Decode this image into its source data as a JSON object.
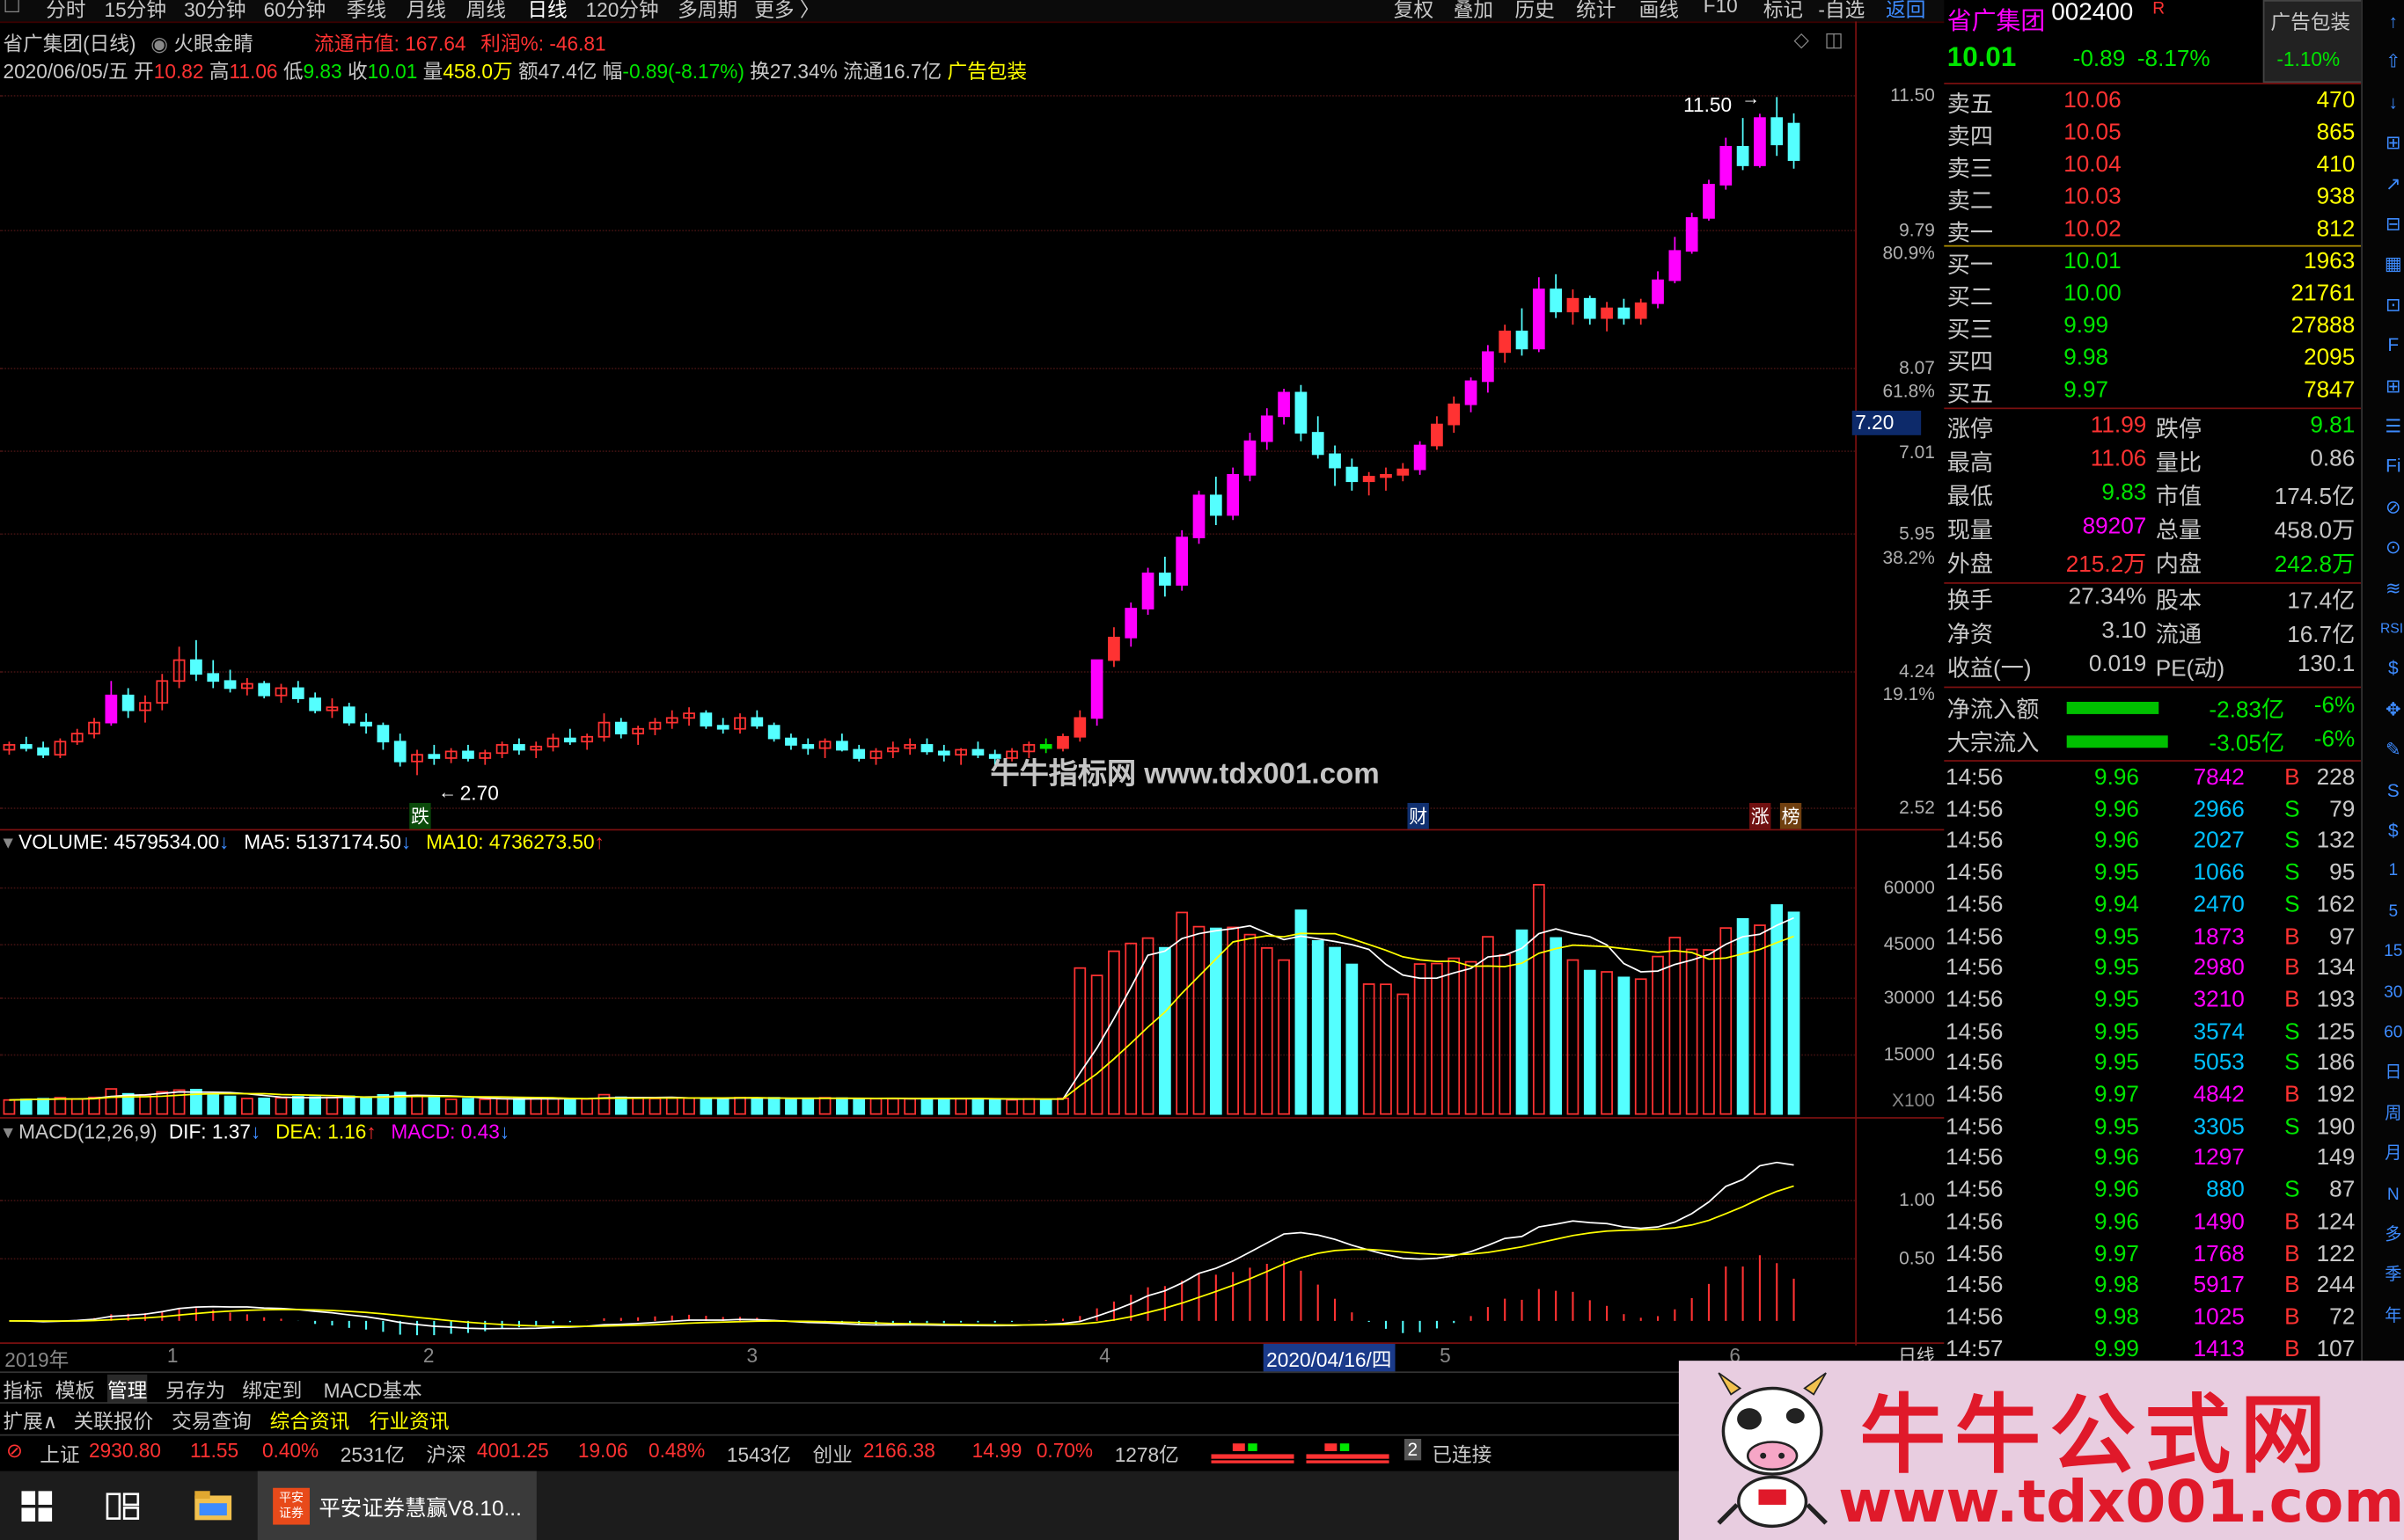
{
  "topbar": {
    "periods": [
      "分时",
      "15分钟",
      "30分钟",
      "60分钟",
      "季线",
      "月线",
      "周线",
      "日线",
      "120分钟",
      "多周期",
      "更多 〉"
    ],
    "active": "日线",
    "right": [
      "复权",
      "叠加",
      "历史",
      "统计",
      "画线",
      "F10",
      "标记",
      "-自选",
      "返回"
    ]
  },
  "header": {
    "title": "省广集团(日线)",
    "indicator": "火眼金睛",
    "float_cap_label": "流通市值:",
    "float_cap": "167.64",
    "profit_label": "利润%:",
    "profit": "-46.81",
    "date": "2020/06/05/五",
    "open_label": "开",
    "open": "10.82",
    "high_label": "高",
    "high": "11.06",
    "low_label": "低",
    "low": "9.83",
    "close_label": "收",
    "close": "10.01",
    "vol_label": "量",
    "vol": "458.0万",
    "amt_label": "额",
    "amt": "47.4亿",
    "chg_label": "幅",
    "chg": "-0.89(-8.17%)",
    "turn_label": "换",
    "turn": "27.34%",
    "circ_label": "流通",
    "circ": "16.7亿",
    "ad": "广告包装"
  },
  "colors": {
    "up": "#ff3232",
    "down": "#54ffff",
    "bull_solid": "#ff00ff",
    "green_mark": "#00e600",
    "ma_white": "#ffffff",
    "ma_yellow": "#ffff00",
    "label_blue": "#3d8bff"
  },
  "chart_data": {
    "type": "candlestick",
    "price_axis": {
      "ticks": [
        "11.50",
        "9.79",
        "8.07",
        "7.01",
        "5.95",
        "4.24",
        "2.52"
      ],
      "pct_ticks": [
        "80.9%",
        "61.8%",
        "38.2%",
        "19.1%"
      ],
      "current_marker": "7.20"
    },
    "max_label": "11.50",
    "min_label": "2.70",
    "marks": [
      "跌",
      "财",
      "涨",
      "榜"
    ],
    "watermark": "牛牛指标网 www.tdx001.com",
    "volume": {
      "title": "VOLUME: 4579534.00",
      "ma5": "MA5: 5137174.50",
      "ma10": "MA10: 4736273.50",
      "ticks": [
        "60000",
        "45000",
        "30000",
        "15000"
      ],
      "unit": "X100"
    },
    "macd": {
      "title": "MACD(12,26,9)",
      "dif": "DIF: 1.37",
      "dea": "DEA: 1.16",
      "macd": "MACD: 0.43",
      "ticks": [
        "1.00",
        "0.50"
      ]
    },
    "x_axis": {
      "labels": [
        "2019年",
        "1",
        "2",
        "3",
        "4",
        "5",
        "6"
      ],
      "cursor_date": "2020/04/16/四",
      "period": "日线"
    },
    "candles": [
      [
        2.85,
        2.9,
        2.82,
        2.88
      ],
      [
        2.88,
        2.93,
        2.84,
        2.86
      ],
      [
        2.86,
        2.9,
        2.8,
        2.82
      ],
      [
        2.82,
        2.92,
        2.8,
        2.9
      ],
      [
        2.9,
        2.98,
        2.88,
        2.95
      ],
      [
        2.95,
        3.05,
        2.92,
        3.02
      ],
      [
        3.02,
        3.3,
        3.0,
        3.2
      ],
      [
        3.2,
        3.25,
        3.05,
        3.1
      ],
      [
        3.1,
        3.2,
        3.02,
        3.15
      ],
      [
        3.15,
        3.35,
        3.1,
        3.3
      ],
      [
        3.3,
        3.55,
        3.25,
        3.45
      ],
      [
        3.45,
        3.6,
        3.3,
        3.35
      ],
      [
        3.35,
        3.45,
        3.25,
        3.3
      ],
      [
        3.3,
        3.38,
        3.22,
        3.25
      ],
      [
        3.25,
        3.32,
        3.2,
        3.28
      ],
      [
        3.28,
        3.3,
        3.18,
        3.2
      ],
      [
        3.2,
        3.28,
        3.15,
        3.25
      ],
      [
        3.25,
        3.3,
        3.15,
        3.18
      ],
      [
        3.18,
        3.22,
        3.08,
        3.1
      ],
      [
        3.1,
        3.18,
        3.05,
        3.12
      ],
      [
        3.12,
        3.15,
        3.0,
        3.02
      ],
      [
        3.02,
        3.08,
        2.95,
        3.0
      ],
      [
        3.0,
        3.02,
        2.85,
        2.9
      ],
      [
        2.9,
        2.95,
        2.75,
        2.78
      ],
      [
        2.78,
        2.85,
        2.7,
        2.82
      ],
      [
        2.82,
        2.88,
        2.76,
        2.8
      ],
      [
        2.8,
        2.86,
        2.77,
        2.84
      ],
      [
        2.84,
        2.88,
        2.78,
        2.8
      ],
      [
        2.8,
        2.85,
        2.76,
        2.83
      ],
      [
        2.83,
        2.9,
        2.8,
        2.88
      ],
      [
        2.88,
        2.92,
        2.82,
        2.85
      ],
      [
        2.85,
        2.9,
        2.8,
        2.87
      ],
      [
        2.87,
        2.95,
        2.84,
        2.92
      ],
      [
        2.92,
        2.98,
        2.88,
        2.9
      ],
      [
        2.9,
        2.95,
        2.85,
        2.93
      ],
      [
        2.93,
        3.08,
        2.9,
        3.02
      ],
      [
        3.02,
        3.05,
        2.92,
        2.95
      ],
      [
        2.95,
        3.0,
        2.88,
        2.98
      ],
      [
        2.98,
        3.05,
        2.94,
        3.02
      ],
      [
        3.02,
        3.1,
        2.98,
        3.05
      ],
      [
        3.05,
        3.12,
        3.0,
        3.08
      ],
      [
        3.08,
        3.1,
        2.98,
        3.0
      ],
      [
        3.0,
        3.05,
        2.95,
        2.98
      ],
      [
        2.98,
        3.08,
        2.95,
        3.05
      ],
      [
        3.05,
        3.1,
        2.98,
        3.0
      ],
      [
        3.0,
        3.02,
        2.9,
        2.92
      ],
      [
        2.92,
        2.95,
        2.85,
        2.88
      ],
      [
        2.88,
        2.92,
        2.82,
        2.86
      ],
      [
        2.86,
        2.92,
        2.8,
        2.9
      ],
      [
        2.9,
        2.95,
        2.84,
        2.85
      ],
      [
        2.85,
        2.88,
        2.78,
        2.8
      ],
      [
        2.8,
        2.86,
        2.76,
        2.84
      ],
      [
        2.84,
        2.9,
        2.8,
        2.86
      ],
      [
        2.86,
        2.92,
        2.82,
        2.88
      ],
      [
        2.88,
        2.92,
        2.82,
        2.84
      ],
      [
        2.84,
        2.88,
        2.78,
        2.82
      ],
      [
        2.82,
        2.86,
        2.76,
        2.85
      ],
      [
        2.85,
        2.9,
        2.8,
        2.82
      ],
      [
        2.82,
        2.85,
        2.76,
        2.8
      ],
      [
        2.8,
        2.86,
        2.78,
        2.84
      ],
      [
        2.84,
        2.9,
        2.8,
        2.88
      ],
      [
        2.88,
        2.92,
        2.83,
        2.86
      ],
      [
        2.86,
        2.95,
        2.84,
        2.93
      ],
      [
        2.93,
        3.1,
        2.9,
        3.05
      ],
      [
        3.05,
        3.2,
        3.0,
        3.45
      ],
      [
        3.45,
        3.7,
        3.4,
        3.62
      ],
      [
        3.62,
        3.9,
        3.55,
        3.85
      ],
      [
        3.85,
        4.2,
        3.8,
        4.15
      ],
      [
        4.15,
        4.3,
        3.95,
        4.05
      ],
      [
        4.05,
        4.55,
        4.0,
        4.48
      ],
      [
        4.48,
        4.95,
        4.42,
        4.9
      ],
      [
        4.9,
        5.1,
        4.6,
        4.7
      ],
      [
        4.7,
        5.2,
        4.65,
        5.12
      ],
      [
        5.12,
        5.6,
        5.05,
        5.5
      ],
      [
        5.5,
        5.9,
        5.4,
        5.8
      ],
      [
        5.8,
        6.15,
        5.7,
        6.1
      ],
      [
        6.1,
        6.2,
        5.5,
        5.6
      ],
      [
        5.6,
        5.8,
        5.3,
        5.35
      ],
      [
        5.35,
        5.45,
        5.0,
        5.2
      ],
      [
        5.2,
        5.3,
        4.95,
        5.05
      ],
      [
        5.05,
        5.15,
        4.9,
        5.1
      ],
      [
        5.1,
        5.2,
        4.95,
        5.12
      ],
      [
        5.12,
        5.25,
        5.05,
        5.18
      ],
      [
        5.18,
        5.5,
        5.12,
        5.45
      ],
      [
        5.45,
        5.8,
        5.4,
        5.7
      ],
      [
        5.7,
        6.05,
        5.6,
        5.95
      ],
      [
        5.95,
        6.3,
        5.85,
        6.25
      ],
      [
        6.25,
        6.75,
        6.1,
        6.65
      ],
      [
        6.65,
        7.05,
        6.5,
        6.95
      ],
      [
        6.95,
        7.3,
        6.6,
        6.7
      ],
      [
        6.7,
        7.8,
        6.65,
        7.6
      ],
      [
        7.6,
        7.85,
        7.15,
        7.25
      ],
      [
        7.25,
        7.6,
        7.05,
        7.45
      ],
      [
        7.45,
        7.5,
        7.05,
        7.15
      ],
      [
        7.15,
        7.4,
        6.95,
        7.3
      ],
      [
        7.3,
        7.45,
        7.05,
        7.15
      ],
      [
        7.15,
        7.45,
        7.05,
        7.38
      ],
      [
        7.38,
        7.9,
        7.3,
        7.75
      ],
      [
        7.75,
        8.5,
        7.7,
        8.25
      ],
      [
        8.25,
        8.95,
        8.2,
        8.85
      ],
      [
        8.85,
        9.6,
        8.8,
        9.5
      ],
      [
        9.5,
        10.5,
        9.4,
        10.3
      ],
      [
        10.3,
        10.95,
        9.8,
        9.9
      ],
      [
        9.9,
        11.05,
        9.85,
        10.95
      ],
      [
        10.95,
        11.45,
        10.1,
        10.35
      ],
      [
        10.82,
        11.06,
        9.83,
        10.01
      ]
    ]
  },
  "quote": {
    "name": "省广集团",
    "code": "002400",
    "badge": "R",
    "ad": "广告包装",
    "price": "10.01",
    "change": "-0.89",
    "pct": "-8.17%",
    "side_pct": "-1.10%",
    "asks": [
      [
        "卖五",
        "10.06",
        "470"
      ],
      [
        "卖四",
        "10.05",
        "865"
      ],
      [
        "卖三",
        "10.04",
        "410"
      ],
      [
        "卖二",
        "10.03",
        "938"
      ],
      [
        "卖一",
        "10.02",
        "812"
      ]
    ],
    "bids": [
      [
        "买一",
        "10.01",
        "1963"
      ],
      [
        "买二",
        "10.00",
        "21761"
      ],
      [
        "买三",
        "9.99",
        "27888"
      ],
      [
        "买四",
        "9.98",
        "2095"
      ],
      [
        "买五",
        "9.97",
        "7847"
      ]
    ],
    "stats": [
      [
        "涨停",
        "11.99",
        "跌停",
        "9.81"
      ],
      [
        "最高",
        "11.06",
        "量比",
        "0.86"
      ],
      [
        "最低",
        "9.83",
        "市值",
        "174.5亿"
      ],
      [
        "现量",
        "89207",
        "总量",
        "458.0万"
      ],
      [
        "外盘",
        "215.2万",
        "内盘",
        "242.8万"
      ]
    ],
    "stats2": [
      [
        "换手",
        "27.34%",
        "股本",
        "17.4亿"
      ],
      [
        "净资",
        "3.10",
        "流通",
        "16.7亿"
      ],
      [
        "收益(一)",
        "0.019",
        "PE(动)",
        "130.1"
      ]
    ],
    "flows": [
      [
        "净流入额",
        "-2.83亿",
        "-6%"
      ],
      [
        "大宗流入",
        "-3.05亿",
        "-6%"
      ]
    ],
    "ticks": [
      [
        "14:56",
        "9.96",
        "7842",
        "B",
        "228"
      ],
      [
        "14:56",
        "9.96",
        "2966",
        "S",
        "79"
      ],
      [
        "14:56",
        "9.96",
        "2027",
        "S",
        "132"
      ],
      [
        "14:56",
        "9.95",
        "1066",
        "S",
        "95"
      ],
      [
        "14:56",
        "9.94",
        "2470",
        "S",
        "162"
      ],
      [
        "14:56",
        "9.95",
        "1873",
        "B",
        "97"
      ],
      [
        "14:56",
        "9.95",
        "2980",
        "B",
        "134"
      ],
      [
        "14:56",
        "9.95",
        "3210",
        "B",
        "193"
      ],
      [
        "14:56",
        "9.95",
        "3574",
        "S",
        "125"
      ],
      [
        "14:56",
        "9.95",
        "5053",
        "S",
        "186"
      ],
      [
        "14:56",
        "9.97",
        "4842",
        "B",
        "192"
      ],
      [
        "14:56",
        "9.95",
        "3305",
        "S",
        "190"
      ],
      [
        "14:56",
        "9.96",
        "1297",
        "",
        "149"
      ],
      [
        "14:56",
        "9.96",
        "880",
        "S",
        "87"
      ],
      [
        "14:56",
        "9.96",
        "1490",
        "B",
        "124"
      ],
      [
        "14:56",
        "9.97",
        "1768",
        "B",
        "122"
      ],
      [
        "14:56",
        "9.98",
        "5917",
        "B",
        "244"
      ],
      [
        "14:56",
        "9.98",
        "1025",
        "B",
        "72"
      ],
      [
        "14:57",
        "9.99",
        "1413",
        "B",
        "107"
      ]
    ]
  },
  "iconbar": [
    "↑",
    "⇧",
    "↓",
    "⊞",
    "↗",
    "⊟",
    "▦",
    "⊡",
    "F",
    "⊞",
    "☰",
    "Fi",
    "⊘",
    "⊙",
    "≋",
    "RSI",
    "$",
    "✥",
    "✎",
    "S",
    "$",
    "1",
    "5",
    "15",
    "30",
    "60",
    "日",
    "周",
    "月",
    "N",
    "多",
    "季",
    "年"
  ],
  "bottom": {
    "tabs1": [
      "指标",
      "模板",
      "管理",
      "另存为",
      "绑定到",
      "MACD基本"
    ],
    "tabs2": [
      "扩展∧",
      "关联报价",
      "交易查询",
      "综合资讯",
      "行业资讯"
    ],
    "market": [
      {
        "name": "上证",
        "val": "2930.80",
        "chg": "11.55",
        "pct": "0.40%",
        "amt": "2531亿"
      },
      {
        "name": "沪深",
        "val": "4001.25",
        "chg": "19.06",
        "pct": "0.48%",
        "amt": "1543亿"
      },
      {
        "name": "创业",
        "val": "2166.38",
        "chg": "14.99",
        "pct": "0.70%",
        "amt": "1278亿"
      }
    ],
    "conn_num": "2",
    "conn": "已连接"
  },
  "taskbar": {
    "app": "平安证券慧赢V8.10...",
    "logo": "平安\n证券"
  },
  "ad_banner": {
    "title": "牛牛公式网",
    "url": "www.tdx001.com"
  }
}
